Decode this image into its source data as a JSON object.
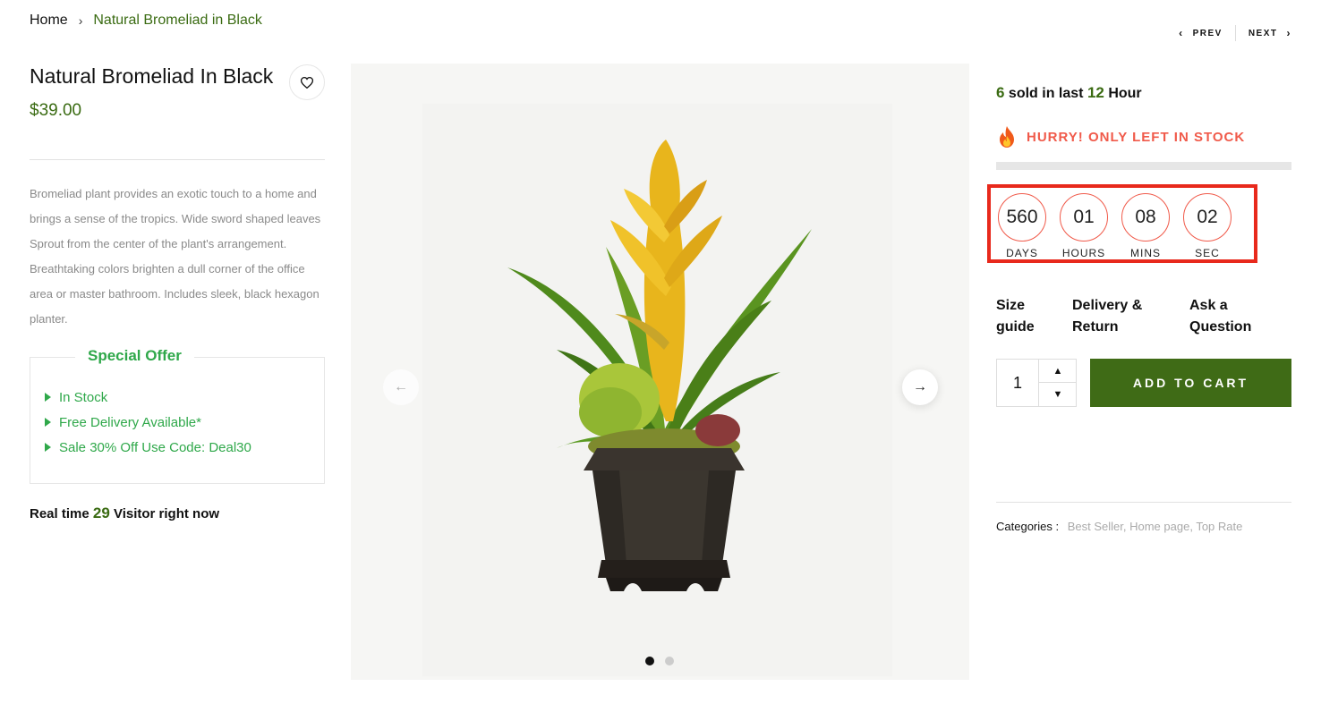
{
  "breadcrumb": {
    "home": "Home",
    "separator": "›",
    "current": "Natural Bromeliad in Black"
  },
  "nav": {
    "prev": "PREV",
    "next": "NEXT"
  },
  "product": {
    "title": "Natural Bromeliad In Black",
    "price": "$39.00",
    "description": "Bromeliad plant provides an exotic touch to a home and brings a sense of the tropics. Wide sword shaped leaves Sprout from the center of the plant's arrangement. Breathtaking colors brighten a dull corner of the office area or master bathroom. Includes sleek, black hexagon planter."
  },
  "special_offer": {
    "title": "Special Offer",
    "items": [
      "In Stock",
      "Free Delivery Available*",
      "Sale 30% Off Use Code: Deal30"
    ]
  },
  "visitors": {
    "prefix": "Real time",
    "count": "29",
    "suffix": "Visitor right now"
  },
  "gallery": {
    "slide_count": 2,
    "active_slide": 1
  },
  "sales": {
    "count": "6",
    "mid": "sold in last",
    "hours": "12",
    "suffix": "Hour"
  },
  "stock": {
    "message": "HURRY! ONLY LEFT IN STOCK",
    "level": 0
  },
  "countdown": [
    {
      "value": "560",
      "label": "DAYS"
    },
    {
      "value": "01",
      "label": "HOURS"
    },
    {
      "value": "08",
      "label": "MINS"
    },
    {
      "value": "02",
      "label": "SEC"
    }
  ],
  "links": {
    "size_guide": [
      "Size",
      "guide"
    ],
    "delivery": [
      "Delivery &",
      "Return"
    ],
    "ask": [
      "Ask a",
      "Question"
    ]
  },
  "cart": {
    "quantity": "1",
    "button": "ADD TO CART"
  },
  "categories": {
    "label": "Categories :",
    "items": [
      "Best Seller",
      "Home page",
      "Top Rate"
    ]
  },
  "colors": {
    "accent_green": "#3a6b12",
    "offer_green": "#2fa84a",
    "hurry_red": "#f05a4a",
    "highlight_red": "#e8291c",
    "button_green": "#3f6b16"
  }
}
